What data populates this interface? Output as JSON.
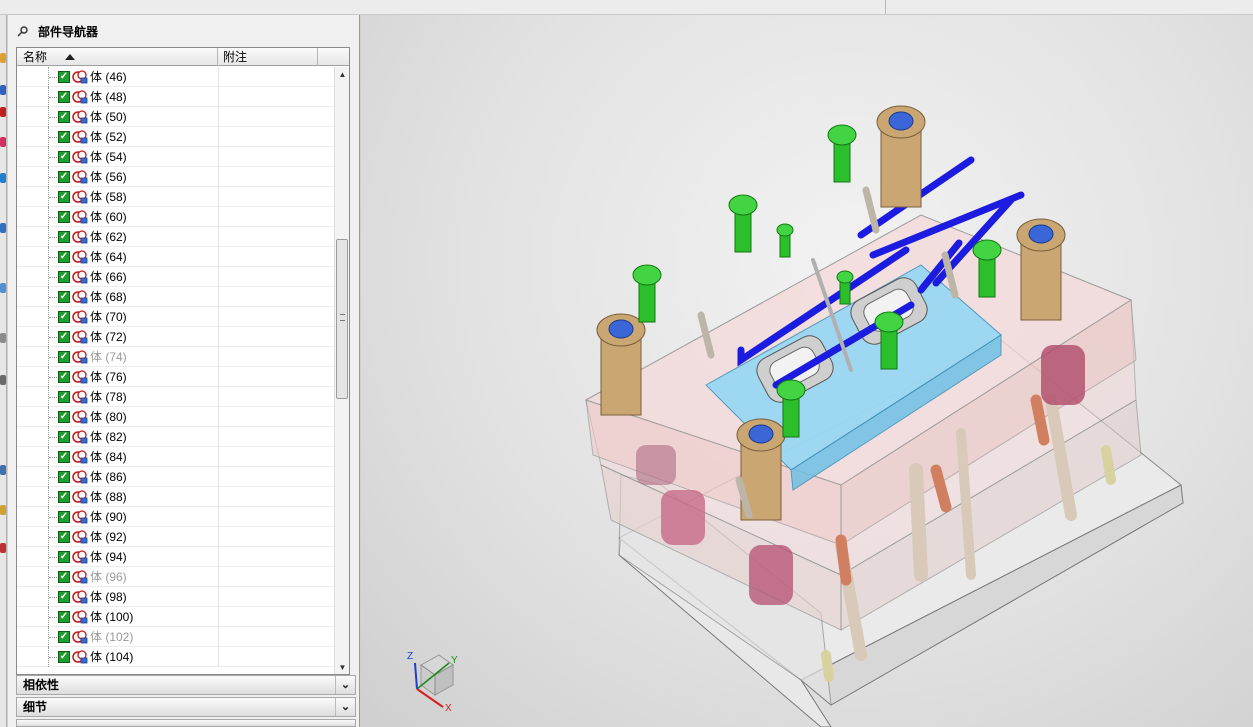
{
  "panel": {
    "title": "部件导航器",
    "columns": {
      "name": "名称",
      "note": "附注"
    },
    "rows": [
      {
        "label": "体 (46)",
        "dim": false
      },
      {
        "label": "体 (48)",
        "dim": false
      },
      {
        "label": "体 (50)",
        "dim": false
      },
      {
        "label": "体 (52)",
        "dim": false
      },
      {
        "label": "体 (54)",
        "dim": false
      },
      {
        "label": "体 (56)",
        "dim": false
      },
      {
        "label": "体 (58)",
        "dim": false
      },
      {
        "label": "体 (60)",
        "dim": false
      },
      {
        "label": "体 (62)",
        "dim": false
      },
      {
        "label": "体 (64)",
        "dim": false
      },
      {
        "label": "体 (66)",
        "dim": false
      },
      {
        "label": "体 (68)",
        "dim": false
      },
      {
        "label": "体 (70)",
        "dim": false
      },
      {
        "label": "体 (72)",
        "dim": false
      },
      {
        "label": "体 (74)",
        "dim": true
      },
      {
        "label": "体 (76)",
        "dim": false
      },
      {
        "label": "体 (78)",
        "dim": false
      },
      {
        "label": "体 (80)",
        "dim": false
      },
      {
        "label": "体 (82)",
        "dim": false
      },
      {
        "label": "体 (84)",
        "dim": false
      },
      {
        "label": "体 (86)",
        "dim": false
      },
      {
        "label": "体 (88)",
        "dim": false
      },
      {
        "label": "体 (90)",
        "dim": false
      },
      {
        "label": "体 (92)",
        "dim": false
      },
      {
        "label": "体 (94)",
        "dim": false
      },
      {
        "label": "体 (96)",
        "dim": true
      },
      {
        "label": "体 (98)",
        "dim": false
      },
      {
        "label": "体 (100)",
        "dim": false
      },
      {
        "label": "体 (102)",
        "dim": true
      },
      {
        "label": "体 (104)",
        "dim": false
      }
    ],
    "sections": {
      "dependencies": "相依性",
      "details": "细节"
    }
  },
  "viewport": {
    "triad": {
      "x": "X",
      "y": "Y",
      "z": "Z"
    }
  },
  "colors": {
    "check_green": "#1f9d2f",
    "cooling_blue": "#1818d8",
    "screw_green": "#2ec02e",
    "bushing_tan": "#c8a472",
    "cavity_cyan": "#7fd0f0",
    "plate_pink": "#f3c8c8"
  }
}
